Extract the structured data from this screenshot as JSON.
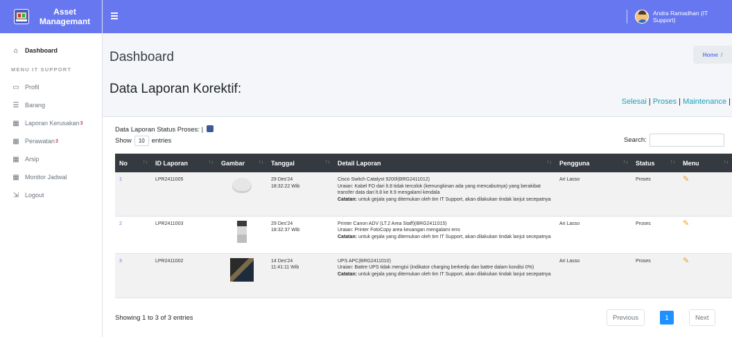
{
  "brand": {
    "line1": "Asset",
    "line2": "Managemant"
  },
  "sidebar": {
    "dashboard": "Dashboard",
    "section_header": "MENU IT SUPPORT",
    "items": [
      {
        "label": "Profil",
        "icon": "profile-card-icon",
        "badge": ""
      },
      {
        "label": "Barang",
        "icon": "list-icon",
        "badge": ""
      },
      {
        "label": "Laporan Kerusakan",
        "icon": "table-icon",
        "badge": "3"
      },
      {
        "label": "Perawatan",
        "icon": "table-icon",
        "badge": "3"
      },
      {
        "label": "Arsip",
        "icon": "table-icon",
        "badge": ""
      },
      {
        "label": "Monitor Jadwal",
        "icon": "table-icon",
        "badge": ""
      },
      {
        "label": "Logout",
        "icon": "logout-icon",
        "badge": ""
      }
    ]
  },
  "topbar": {
    "user": "Andra Ramadhan (IT Support)"
  },
  "page": {
    "title": "Dashboard",
    "breadcrumb": {
      "home": "Home",
      "sep": "/"
    },
    "section_title": "Data Laporan Korektif:",
    "status_links": {
      "selesai": "Selesai",
      "proses": "Proses",
      "maintenance": "Maintenance",
      "sep": "|"
    }
  },
  "table_card": {
    "subtitle": "Data Laporan Status Proses: |",
    "show_prefix": "Show",
    "show_value": "10",
    "show_suffix": "entries",
    "search_label": "Search:",
    "columns": [
      "No",
      "ID Laporan",
      "Gambar",
      "Tanggal",
      "Detail Laporan",
      "Pengguna",
      "Status",
      "Menu"
    ],
    "rows": [
      {
        "no": "1",
        "id": "LPR2411005",
        "image": "router-image",
        "date": "29 Des'24",
        "time": "18:32:22 Wib",
        "title": "Cisco Switch Catalyst 9200l(BRG2411012)",
        "uraian": "Uraian: Kabel FO dari lt.8 tidak tercolok (kemungkinan ada yang mencabutnya) yang berakibat transfer data dari lt.8 ke lt.9 mengalami kendala",
        "catatan_label": "Catatan:",
        "catatan": " untuk gejala yang ditemukan oleh tim IT Support, akan dilakukan tindak lanjut secepatnya",
        "user": "Ari Lasso",
        "status": "Proses"
      },
      {
        "no": "2",
        "id": "LPR2411003",
        "image": "printer-image",
        "date": "29 Des'24",
        "time": "18:32:37 Wib",
        "title": "Printer Canon ADV (LT.2 Area Staff)(BRG2411015)",
        "uraian": "Uraian: Printer FotoCopy area keuangan mengalami erro",
        "catatan_label": "Catatan:",
        "catatan": " untuk gejala yang ditemukan oleh tim IT Support, akan dilakukan tindak lanjut secepatnya",
        "user": "Ari Lasso",
        "status": "Proses"
      },
      {
        "no": "3",
        "id": "LPR2411002",
        "image": "ups-image",
        "date": "14 Des'24",
        "time": "11:41:11 Wib",
        "title": "UPS APC(BRG2411010)",
        "uraian": "Uraian: Battre UPS tidak mengisi (indikator charging berkedip dan battre dalam kondisi 0%)",
        "catatan_label": "Catatan:",
        "catatan": " untuk gejala yang ditemukan oleh tim IT Support, akan dilakukan tindak lanjut secepatnya",
        "user": "Ari Lasso",
        "status": "Proses"
      }
    ],
    "info": "Showing 1 to 3 of 3 entries",
    "pagination": {
      "previous": "Previous",
      "current": "1",
      "next": "Next"
    }
  },
  "colors": {
    "primary": "#6777ef",
    "table_header": "#343a40",
    "link": "#17a2b8",
    "edit": "#f39c12",
    "badge": "#dc3545"
  }
}
